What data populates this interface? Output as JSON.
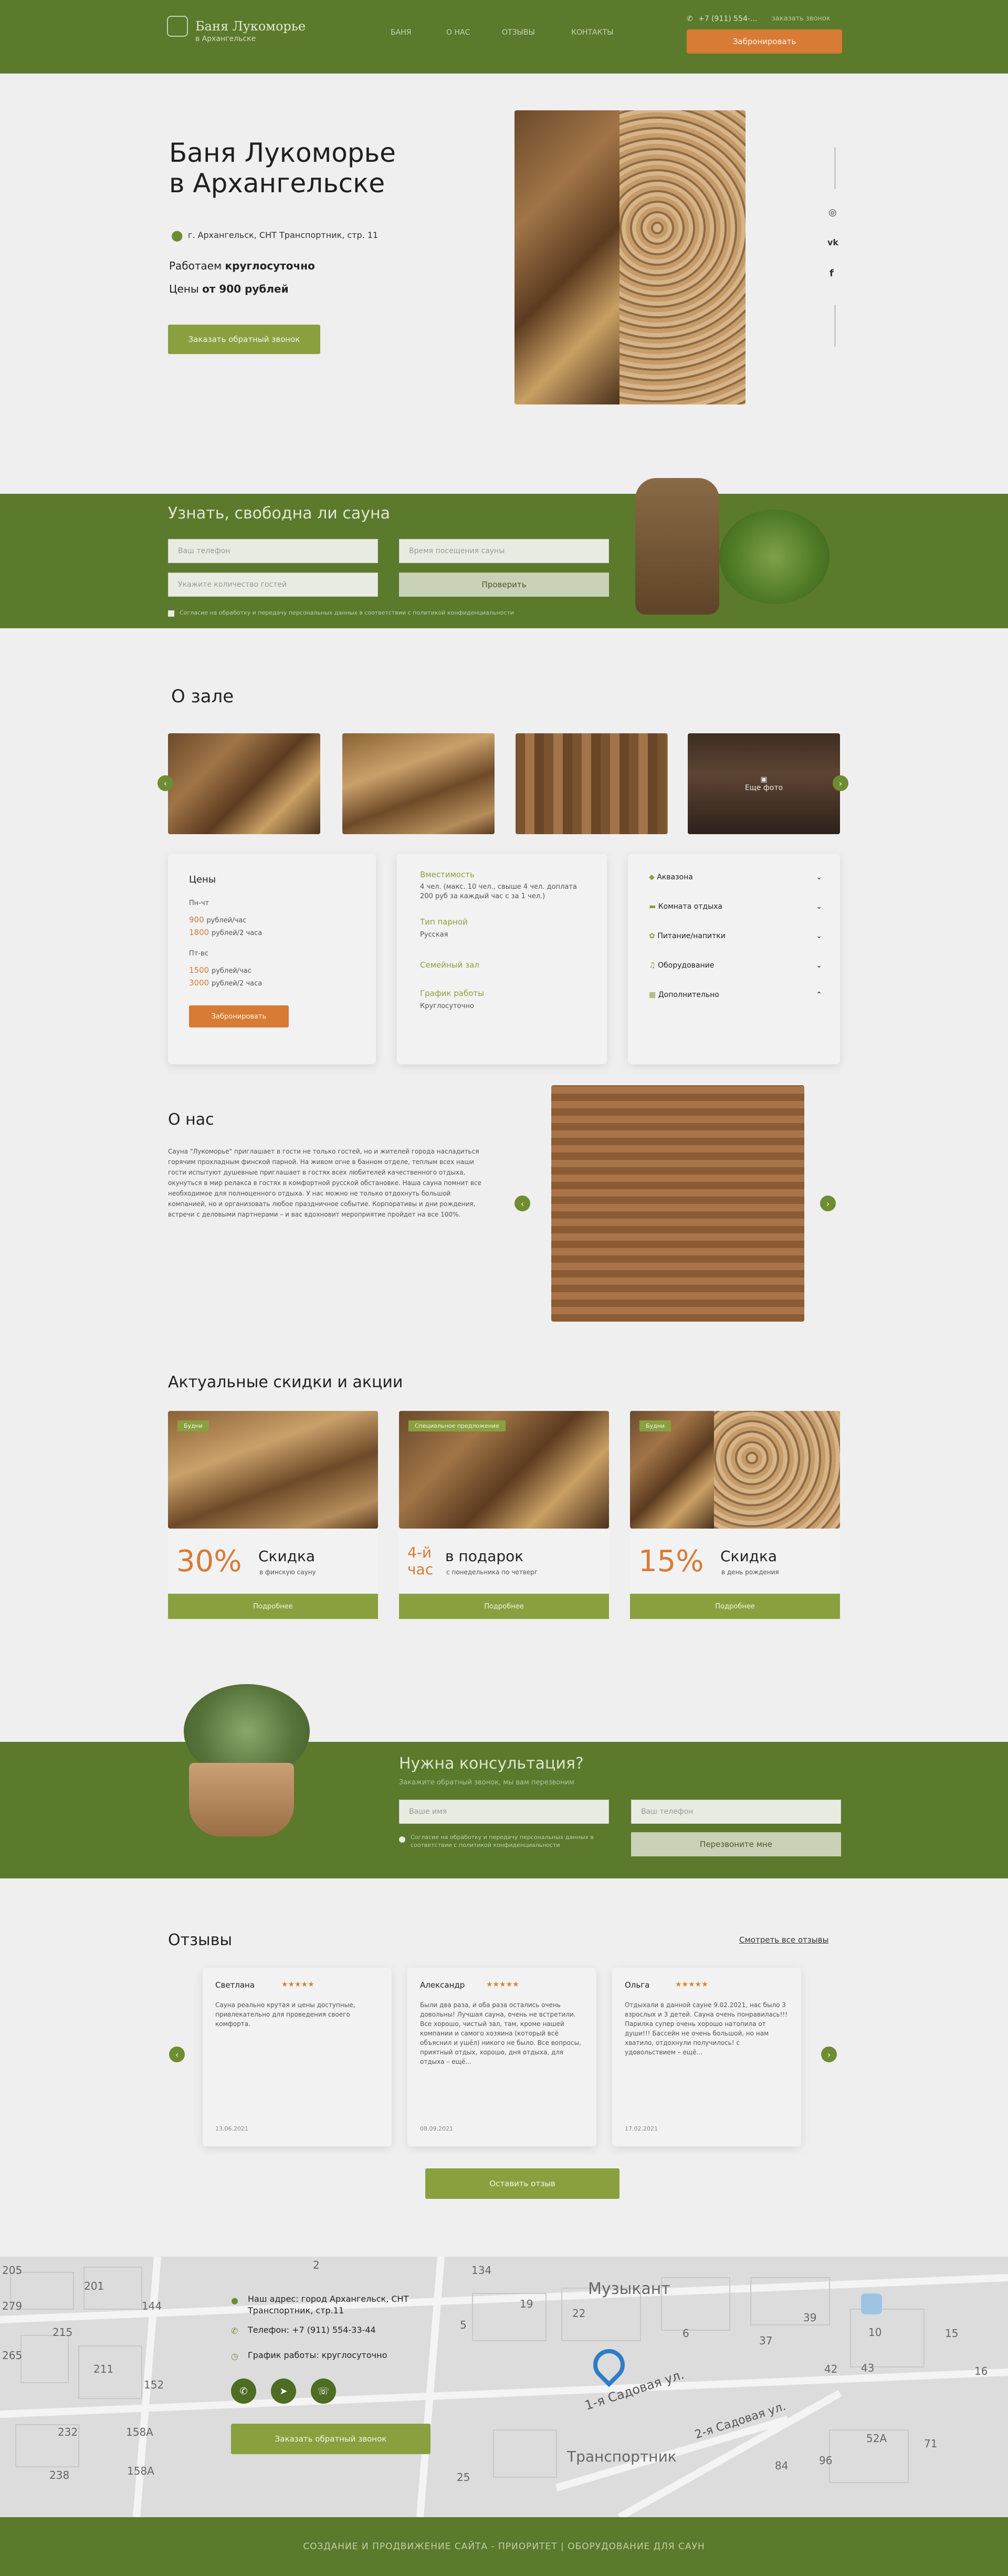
{
  "header": {
    "logo_title": "Баня Лукоморье",
    "logo_subtitle": "в Архангельске",
    "nav": [
      "БАНЯ",
      "О НАС",
      "ОТЗЫВЫ",
      "КОНТАКТЫ"
    ],
    "phone": "+7 (911) 554-...",
    "callback": "заказать звонок",
    "cta": "Забронировать"
  },
  "hero": {
    "title_line1": "Баня Лукоморье",
    "title_line2": "в Архангельске",
    "address": "г. Архангельск, СНТ Транспортник, стр. 11",
    "hours_prefix": "Работаем ",
    "hours_value": "круглосуточно",
    "price_prefix": "Цены ",
    "price_value": "от 900 рублей",
    "button": "Заказать обратный звонок",
    "social": [
      "instagram-icon",
      "vk-icon",
      "facebook-icon"
    ]
  },
  "availability": {
    "title": "Узнать, свободна ли сауна",
    "name_placeholder": "Ваш телефон",
    "date_placeholder": "Время посещения сауны",
    "count_placeholder": "Укажите количество гостей",
    "check_button": "Проверить",
    "consent": "Согласие на обработку и передачу персональных данных в соответствии с политикой конфиденциальности"
  },
  "hall": {
    "title": "О зале",
    "gallery_more": "Еще фото",
    "prices_title": "Цены",
    "weekday_label": "Пн-чт",
    "weekday_price1": "900",
    "weekday_unit1": "рублей/час",
    "weekday_price2": "1800",
    "weekday_unit2": "рублей/2 часа",
    "weekend_label": "Пт-вс",
    "weekend_price1": "1500",
    "weekend_unit1": "рублей/час",
    "weekend_price2": "3000",
    "weekend_unit2": "рублей/2 часа",
    "book_button": "Забронировать",
    "capacity_label": "Вместимость",
    "capacity_value": "4 чел. (макс. 10 чел., свыше 4 чел. доплата 200 руб за каждый час с за 1 чел.)",
    "steam_label": "Тип парной",
    "steam_value": "Русская",
    "family_label": "Семейный зал",
    "schedule_label": "График работы",
    "schedule_value": "Круглосуточно",
    "amenities": [
      "Аквазона",
      "Комната отдыха",
      "Питание/напитки",
      "Оборудование",
      "Дополнительно"
    ]
  },
  "about": {
    "title": "О нас",
    "text": "Сауна \"Лукоморье\" приглашает в гости не только гостей, но и жителей города насладиться горячим прохладным финской парной. На живом огне в банном отделе, теплым всех наши гости испытуют душевные приглашает в гостях всех любителей качественного отдыха, окунуться в мир релакса в гостях в комфортной русской обстановке. Наша сауна помнит все необходимое для полноценного отдыха. У нас можно не только отдохнуть большой компанией, но и организовать любое праздничное событие. Корпоративы и дни рождения, встречи с деловыми партнерами – и вас вдохновит мероприятие пройдет на все 100%."
  },
  "promo": {
    "title": "Актуальные скидки и акции",
    "cards": [
      {
        "tag": "Будни",
        "big": "30%",
        "head": "Скидка",
        "sub": "в финскую сауну",
        "button": "Подробнее"
      },
      {
        "tag": "Специальное предложение",
        "big": "4-й час",
        "head": "в подарок",
        "sub": "с понедельника по четверг",
        "button": "Подробнее"
      },
      {
        "tag": "Будни",
        "big": "15%",
        "head": "Скидка",
        "sub": "в день рождения",
        "button": "Подробнее"
      }
    ]
  },
  "consult": {
    "title": "Нужна консультация?",
    "subtitle": "Закажите обратный звонок, мы вам перезвоним",
    "name_placeholder": "Ваше имя",
    "phone_placeholder": "Ваш телефон",
    "consent": "Согласие на обработку и передачу персональных данных в соответствии с политикой конфиденциальности",
    "button": "Перезвоните мне"
  },
  "reviews": {
    "title": "Отзывы",
    "all_link": "Смотреть все отзывы",
    "items": [
      {
        "name": "Светлана",
        "stars": "★★★★★",
        "text": "Сауна реально крутая и цены доступные, привлекательно для проведения своего комфорта.",
        "date": "13.06.2021"
      },
      {
        "name": "Александр",
        "stars": "★★★★★",
        "text": "Были два раза, и оба раза остались очень довольны! Лучшая сауна, очень не встретили. Все хорошо, чистый зал, там, кроме нашей компании и самого хозяина (который всё объяснил и ушёл) никого не было. Все вопросы, приятный отдых, хорошо, дня отдыха, для отдыха – ещё...",
        "date": "08.09.2021"
      },
      {
        "name": "Ольга",
        "stars": "★★★★★",
        "text": "Отдыхали в данной сауне 9.02.2021, нас было 3 взрослых и 3 детей. Сауна очень понравилась!!! Парилка супер очень хорошо натопила от души!!! Бассейн не очень большой, но нам хватило, отдохнули получилось! с удовольствием – ещё...",
        "date": "17.02.2021"
      }
    ],
    "leave_button": "Оставить отзыв"
  },
  "contacts": {
    "address": "Наш адрес: город Архангельск, СНТ Транспортник, стр.11",
    "phone": "Телефон: +7 (911) 554-33-44",
    "hours": "График работы: круглосуточно",
    "button": "Заказать обратный звонок",
    "map_labels": [
      "Музыкант",
      "1-я Садовая ул.",
      "2-я Садовая ул.",
      "Транспортник",
      "205",
      "201",
      "279",
      "215",
      "211",
      "265",
      "152",
      "144",
      "134",
      "232",
      "158А",
      "238",
      "158А",
      "19",
      "22",
      "6",
      "37",
      "39",
      "10",
      "15",
      "16",
      "42",
      "43",
      "52А",
      "71",
      "96",
      "84",
      "25",
      "2",
      "5"
    ]
  },
  "footer": {
    "text": "СОЗДАНИЕ И ПРОДВИЖЕНИЕ САЙТА - ПРИОРИТЕТ | ОБОРУДОВАНИЕ ДЛЯ САУН"
  },
  "colors": {
    "green": "#5b7a2c",
    "accent": "#d77b35",
    "button_green": "#8aa03f"
  }
}
